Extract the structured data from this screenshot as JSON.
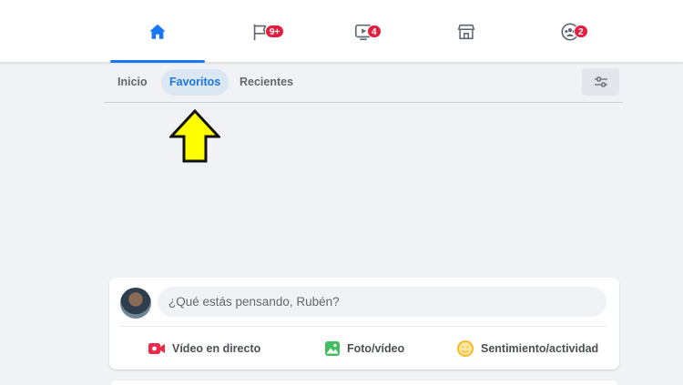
{
  "nav": {
    "tabs": [
      {
        "icon": "home-icon",
        "badge": ""
      },
      {
        "icon": "flag-icon",
        "badge": "9+"
      },
      {
        "icon": "watch-icon",
        "badge": "4"
      },
      {
        "icon": "marketplace-icon",
        "badge": ""
      },
      {
        "icon": "groups-icon",
        "badge": "2"
      }
    ]
  },
  "feed_tabs": {
    "items": [
      {
        "label": "Inicio"
      },
      {
        "label": "Favoritos"
      },
      {
        "label": "Recientes"
      }
    ],
    "selected": "Favoritos",
    "filter_icon": "filter-settings-icon"
  },
  "annotation": {
    "icon": "yellow-up-arrow-icon",
    "color": "#ffff00"
  },
  "composer": {
    "placeholder": "¿Qué estás pensando, Rubén?",
    "actions": [
      {
        "label": "Vídeo en directo",
        "icon": "live-video-icon",
        "color": "#f02849"
      },
      {
        "label": "Foto/vídeo",
        "icon": "photo-video-icon",
        "color": "#45bd62"
      },
      {
        "label": "Sentimiento/actividad",
        "icon": "feeling-activity-icon",
        "color": "#f7b928"
      }
    ]
  },
  "colors": {
    "accent": "#1877f2",
    "badge": "#e41e3f",
    "background": "#f0f2f5"
  }
}
